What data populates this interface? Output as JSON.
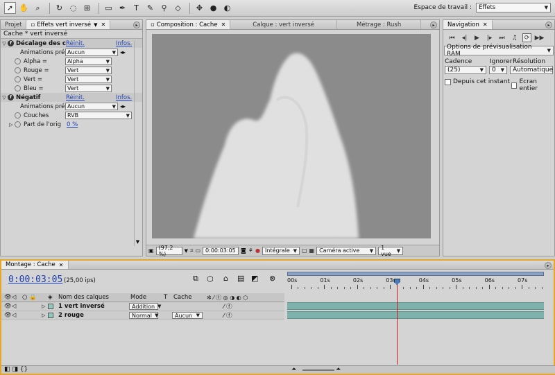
{
  "toolbar": {
    "tools": [
      "selection-tool",
      "hand-tool",
      "zoom-tool",
      "rotate-tool",
      "orbit-camera-tool",
      "pan-behind-tool",
      "rectangle-mask-tool",
      "pen-tool",
      "text-tool",
      "brush-tool",
      "clone-stamp-tool",
      "eraser-tool"
    ],
    "workspace_label": "Espace de travail :",
    "workspace_value": "Effets"
  },
  "effects_panel": {
    "tab_project": "Projet",
    "tab_effects": "Effets vert inversé",
    "title": "Cache * vert inversé",
    "effect1": {
      "name": "Décalage des c",
      "reset": "Réinit.",
      "about": "Infos.",
      "animations_label": "Animations préd",
      "animations_value": "Aucun",
      "params": [
        {
          "label": "Alpha =",
          "value": "Alpha"
        },
        {
          "label": "Rouge =",
          "value": "Vert"
        },
        {
          "label": "Vert =",
          "value": "Vert"
        },
        {
          "label": "Bleu =",
          "value": "Vert"
        }
      ]
    },
    "effect2": {
      "name": "Négatif",
      "reset": "Réinit.",
      "about": "Infos.",
      "animations_label": "Animations préd",
      "animations_value": "Aucun",
      "channel_label": "Couches",
      "channel_value": "RVB",
      "blend_label": "Part de l'orig",
      "blend_value": "0 %"
    }
  },
  "composition": {
    "tab_comp": "Composition : Cache",
    "tab_layer": "Calque : vert inversé",
    "tab_footage": "Métrage : Rush",
    "zoom": "(97,2 %)",
    "timecode": "0:00:03:05",
    "resolution": "Intégrale",
    "camera": "Caméra active",
    "views": "1 vue"
  },
  "navigation": {
    "tab": "Navigation",
    "ram_options": "Options de prévisualisation RAM",
    "cadence_label": "Cadence",
    "ignore_label": "Ignorer",
    "resolution_label": "Résolution",
    "cadence_value": "(25)",
    "ignore_value": "0",
    "resolution_value": "Automatique",
    "from_current": "Depuis cet instant",
    "full_screen": "Ecran entier"
  },
  "timeline": {
    "tab": "Montage : Cache",
    "timecode": "0:00:03:05",
    "fps": "(25,00 ips)",
    "col_layer_name": "Nom des calques",
    "col_mode": "Mode",
    "col_t": "T",
    "col_track_matte": "Cache",
    "ruler_labels": [
      "00s",
      "01s",
      "02s",
      "03s",
      "04s",
      "05s",
      "06s",
      "07s"
    ],
    "layers": [
      {
        "number": "1",
        "name": "vert inversé",
        "mode": "Addition",
        "matte": ""
      },
      {
        "number": "2",
        "name": "rouge",
        "mode": "Normal",
        "matte": "Aucun"
      }
    ],
    "current_time_seconds": 3.2,
    "duration_seconds": 7.8
  }
}
